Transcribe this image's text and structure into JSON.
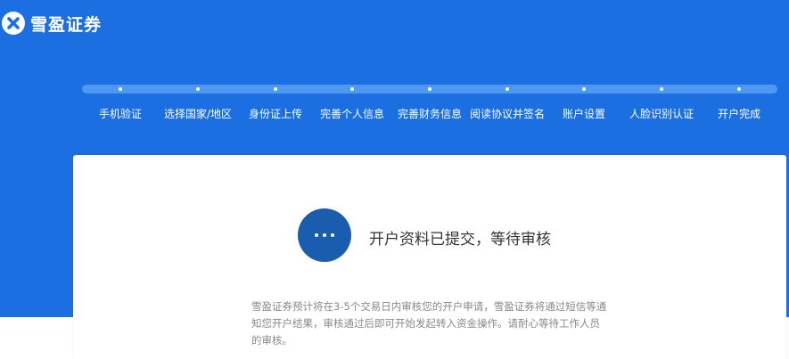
{
  "brand": {
    "name": "雪盈证券",
    "logo_icon": "x-circle-icon"
  },
  "steps": [
    {
      "label": "手机验证"
    },
    {
      "label": "选择国家/地区"
    },
    {
      "label": "身份证上传"
    },
    {
      "label": "完善个人信息"
    },
    {
      "label": "完善财务信息"
    },
    {
      "label": "阅读协议并签名"
    },
    {
      "label": "账户设置"
    },
    {
      "label": "人脸识别认证"
    },
    {
      "label": "开户完成"
    }
  ],
  "status": {
    "icon": "ellipsis-icon",
    "title": "开户资料已提交，等待审核",
    "description": "雪盈证券预计将在3-5个交易日内审核您的开户申请，雪盈证券将通过短信等通知您开户结果，审核通过后即可开始发起转入资金操作。请耐心等待工作人员的审核。"
  },
  "colors": {
    "hero_bg": "#1b6fe0",
    "track": "#4f98f2",
    "status_icon_bg": "#1a5cae"
  }
}
